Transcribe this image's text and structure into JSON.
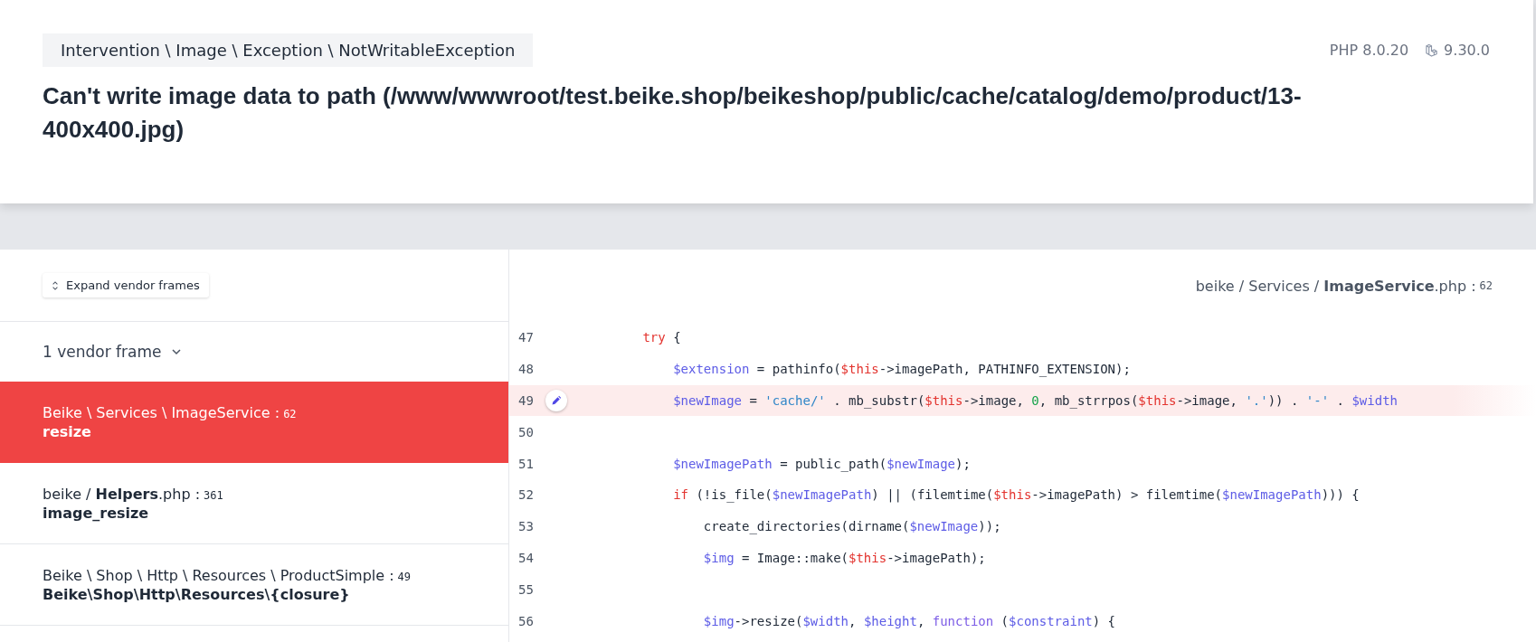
{
  "header": {
    "exception_class": "Intervention \\ Image \\ Exception \\ NotWritableException",
    "php_version": "PHP 8.0.20",
    "laravel_version": "9.30.0",
    "message": "Can't write image data to path (/www/wwwroot/test.beike.shop/beikeshop/public/cache/catalog/demo/product/13-400x400.jpg)"
  },
  "frames_panel": {
    "expand_button": "Expand vendor frames",
    "vendor_group": {
      "label": "1 vendor frame",
      "expanded": false
    },
    "frames": [
      {
        "location": "Beike \\ Services \\ ImageService :",
        "line": "62",
        "method": "resize",
        "selected": true
      },
      {
        "location": "beike / **Helpers**.php :",
        "line": "361",
        "method": "image_resize",
        "selected": false
      },
      {
        "location": "Beike \\ Shop \\ Http \\ Resources \\ ProductSimple :",
        "line": "49",
        "method": "Beike\\Shop\\Http\\Resources\\{closure}",
        "selected": false
      }
    ]
  },
  "code_panel": {
    "file_path": "beike / Services / **ImageService**.php :",
    "line": "62",
    "lines": [
      {
        "number": "47",
        "selected": false,
        "tokens": [
          {
            "kind": "keyword",
            "text": "        try"
          },
          {
            "kind": "plain",
            "text": " {"
          }
        ]
      },
      {
        "number": "48",
        "selected": false,
        "tokens": [
          {
            "kind": "variable",
            "text": "            $extension"
          },
          {
            "kind": "plain",
            "text": " = pathinfo("
          },
          {
            "kind": "this",
            "text": "$this"
          },
          {
            "kind": "plain",
            "text": "->imagePath, PATHINFO_EXTENSION);"
          }
        ]
      },
      {
        "number": "49",
        "selected": true,
        "tokens": [
          {
            "kind": "variable",
            "text": "            $newImage"
          },
          {
            "kind": "plain",
            "text": " = "
          },
          {
            "kind": "string",
            "text": "'cache/'"
          },
          {
            "kind": "plain",
            "text": " . mb_substr("
          },
          {
            "kind": "this",
            "text": "$this"
          },
          {
            "kind": "plain",
            "text": "->image, "
          },
          {
            "kind": "number",
            "text": "0"
          },
          {
            "kind": "plain",
            "text": ", mb_strrpos("
          },
          {
            "kind": "this",
            "text": "$this"
          },
          {
            "kind": "plain",
            "text": "->image, "
          },
          {
            "kind": "string",
            "text": "'.'"
          },
          {
            "kind": "plain",
            "text": ")) . "
          },
          {
            "kind": "string",
            "text": "'-'"
          },
          {
            "kind": "plain",
            "text": " . "
          },
          {
            "kind": "variable",
            "text": "$width"
          }
        ]
      },
      {
        "number": "50",
        "selected": false
      },
      {
        "number": "51",
        "selected": false,
        "tokens": [
          {
            "kind": "variable",
            "text": "            $newImagePath"
          },
          {
            "kind": "plain",
            "text": " = public_path("
          },
          {
            "kind": "variable",
            "text": "$newImage"
          },
          {
            "kind": "plain",
            "text": ");"
          }
        ]
      },
      {
        "number": "52",
        "selected": false,
        "tokens": [
          {
            "kind": "keyword",
            "text": "            if"
          },
          {
            "kind": "plain",
            "text": " (!is_file("
          },
          {
            "kind": "variable",
            "text": "$newImagePath"
          },
          {
            "kind": "plain",
            "text": ") || (filemtime("
          },
          {
            "kind": "this",
            "text": "$this"
          },
          {
            "kind": "plain",
            "text": "->imagePath) > filemtime("
          },
          {
            "kind": "variable",
            "text": "$newImagePath"
          },
          {
            "kind": "plain",
            "text": "))) {"
          }
        ]
      },
      {
        "number": "53",
        "selected": false,
        "tokens": [
          {
            "kind": "plain",
            "text": "                create_directories(dirname("
          },
          {
            "kind": "variable",
            "text": "$newImage"
          },
          {
            "kind": "plain",
            "text": "));"
          }
        ]
      },
      {
        "number": "54",
        "selected": false,
        "tokens": [
          {
            "kind": "variable",
            "text": "                $img"
          },
          {
            "kind": "plain",
            "text": " = Image::make("
          },
          {
            "kind": "this",
            "text": "$this"
          },
          {
            "kind": "plain",
            "text": "->imagePath);"
          }
        ]
      },
      {
        "number": "55",
        "selected": false
      },
      {
        "number": "56",
        "selected": false,
        "tokens": [
          {
            "kind": "variable",
            "text": "                $img"
          },
          {
            "kind": "plain",
            "text": "->resize("
          },
          {
            "kind": "variable",
            "text": "$width"
          },
          {
            "kind": "plain",
            "text": ", "
          },
          {
            "kind": "variable",
            "text": "$height"
          },
          {
            "kind": "plain",
            "text": ", "
          },
          {
            "kind": "function",
            "text": "function"
          },
          {
            "kind": "plain",
            "text": " ("
          },
          {
            "kind": "variable",
            "text": "$constraint"
          },
          {
            "kind": "plain",
            "text": ") {"
          }
        ]
      }
    ]
  }
}
